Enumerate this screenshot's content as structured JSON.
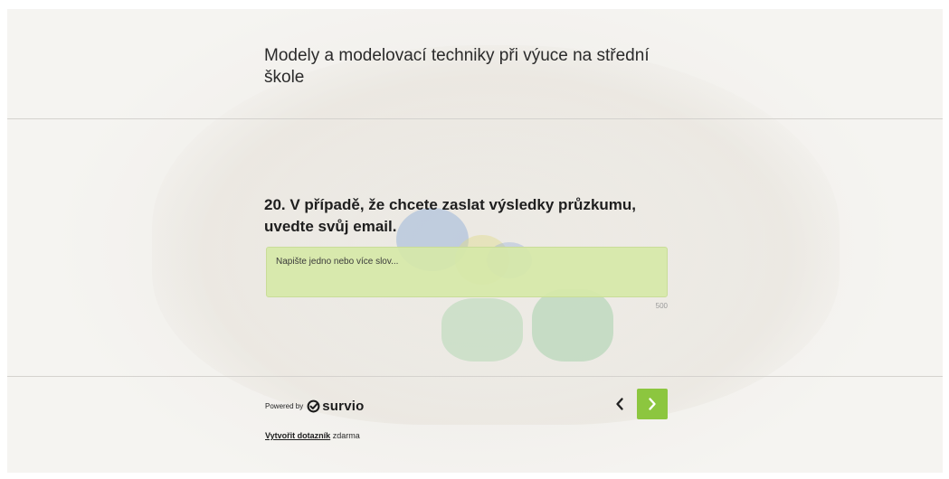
{
  "survey": {
    "title": "Modely a modelovací techniky při výuce na střední škole"
  },
  "question": {
    "title": "20. V případě, že chcete zaslat výsledky průzkumu, uvedte svůj email.",
    "placeholder": "Napište jedno nebo více slov...",
    "value": "",
    "char_limit": "500"
  },
  "footer": {
    "powered_by": "Powered by",
    "brand_name": "survio",
    "brand_icon": "survio-logo-icon",
    "create_link": "Vytvořit dotazník",
    "create_suffix": "zdarma"
  },
  "navigation": {
    "prev_icon": "chevron-left-icon",
    "next_icon": "chevron-right-icon"
  },
  "colors": {
    "accent": "#8cc63f",
    "field_background": "#d6e8a8",
    "divider": "#d4d2ce"
  }
}
